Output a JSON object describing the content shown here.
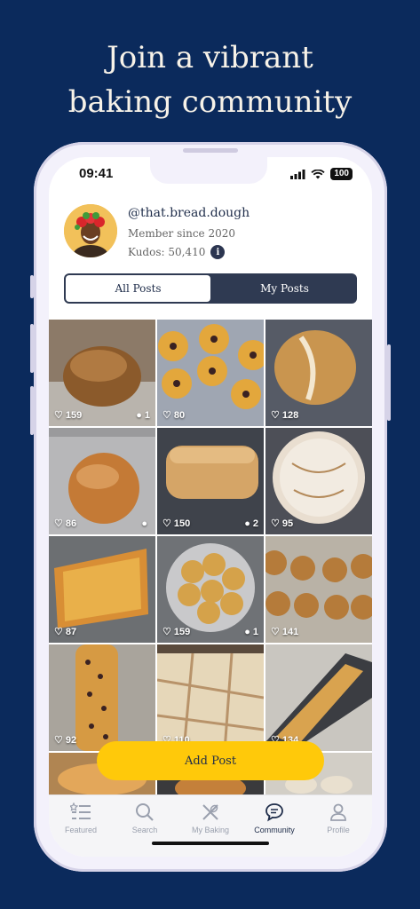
{
  "headline": {
    "line1": "Join a vibrant",
    "line2": "baking community"
  },
  "status": {
    "time": "09:41",
    "battery": "100"
  },
  "profile": {
    "handle": "@that.bread.dough",
    "member_since": "Member since 2020",
    "kudos": "Kudos: 50,410",
    "info_glyph": "i"
  },
  "tabs": [
    {
      "label": "All Posts",
      "active": true
    },
    {
      "label": "My Posts",
      "active": false
    }
  ],
  "posts": [
    {
      "likes": "159",
      "comments": "1",
      "subject": "sourdough boule"
    },
    {
      "likes": "80",
      "comments": "",
      "subject": "jam cookies"
    },
    {
      "likes": "128",
      "comments": "",
      "subject": "scored loaf"
    },
    {
      "likes": "86",
      "comments": "",
      "subject": "brioche bun"
    },
    {
      "likes": "150",
      "comments": "2",
      "subject": "sandwich loaf"
    },
    {
      "likes": "95",
      "comments": "",
      "subject": "floured boule"
    },
    {
      "likes": "87",
      "comments": "",
      "subject": "pizza"
    },
    {
      "likes": "159",
      "comments": "1",
      "subject": "pull-apart rolls"
    },
    {
      "likes": "141",
      "comments": "",
      "subject": "bagels"
    },
    {
      "likes": "92",
      "comments": "",
      "subject": "chocolate bread"
    },
    {
      "likes": "110",
      "comments": "",
      "subject": "focaccia"
    },
    {
      "likes": "134",
      "comments": "",
      "subject": "garlic bread"
    }
  ],
  "add_post_label": "Add Post",
  "tabbar": [
    {
      "label": "Featured",
      "icon": "featured-list-icon",
      "active": false
    },
    {
      "label": "Search",
      "icon": "search-icon",
      "active": false
    },
    {
      "label": "My Baking",
      "icon": "whisk-icon",
      "active": false
    },
    {
      "label": "Community",
      "icon": "chat-bubble-icon",
      "active": true
    },
    {
      "label": "Profile",
      "icon": "person-icon",
      "active": false
    }
  ],
  "colors": {
    "background": "#0b2a5c",
    "accent": "#ffc90a",
    "tab_dark": "#2f3a52"
  }
}
